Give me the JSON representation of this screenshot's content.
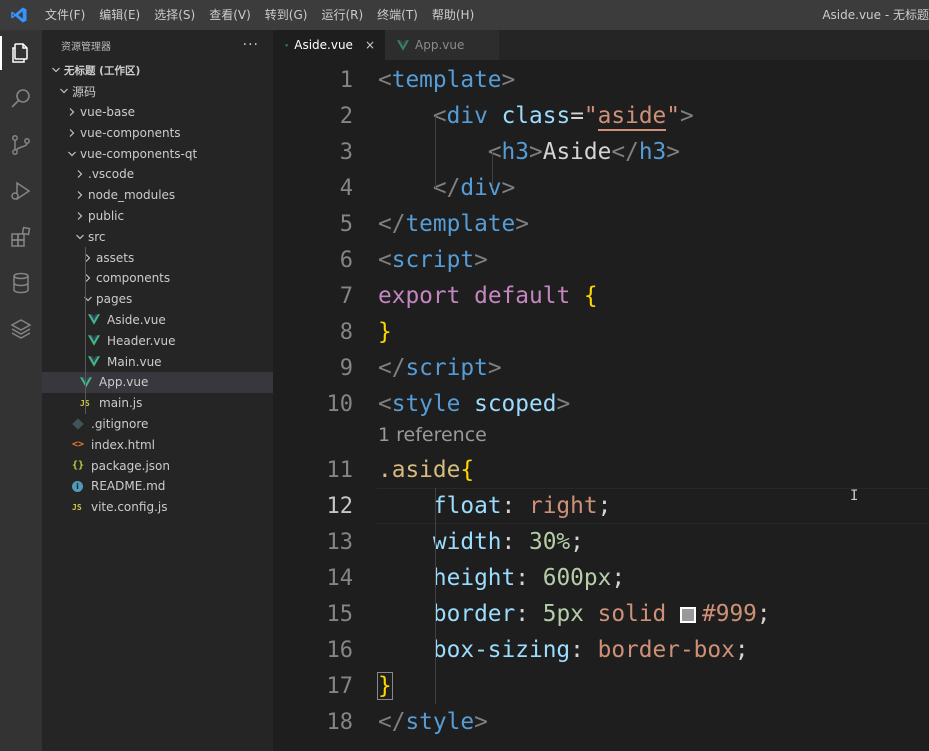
{
  "titlebar": {
    "menu": [
      "文件(F)",
      "编辑(E)",
      "选择(S)",
      "查看(V)",
      "转到(G)",
      "运行(R)",
      "终端(T)",
      "帮助(H)"
    ],
    "window_title": "Aside.vue - 无标题"
  },
  "activity_bar": {
    "icons": [
      "explorer-icon",
      "search-icon",
      "source-control-icon",
      "run-debug-icon",
      "extensions-icon",
      "database-icon",
      "layers-icon"
    ]
  },
  "sidebar": {
    "title": "资源管理器",
    "more": "···",
    "tree": [
      {
        "label": "无标题 (工作区)",
        "type": "workspace",
        "depth": 0,
        "expanded": true
      },
      {
        "label": "源码",
        "type": "folder",
        "depth": 1,
        "expanded": true
      },
      {
        "label": "vue-base",
        "type": "folder",
        "depth": 2,
        "expanded": false
      },
      {
        "label": "vue-components",
        "type": "folder",
        "depth": 2,
        "expanded": false
      },
      {
        "label": "vue-components-qt",
        "type": "folder",
        "depth": 2,
        "expanded": true
      },
      {
        "label": ".vscode",
        "type": "folder",
        "depth": 3,
        "expanded": false
      },
      {
        "label": "node_modules",
        "type": "folder",
        "depth": 3,
        "expanded": false
      },
      {
        "label": "public",
        "type": "folder",
        "depth": 3,
        "expanded": false
      },
      {
        "label": "src",
        "type": "folder",
        "depth": 3,
        "expanded": true
      },
      {
        "label": "assets",
        "type": "folder",
        "depth": 4,
        "expanded": false
      },
      {
        "label": "components",
        "type": "folder",
        "depth": 4,
        "expanded": false
      },
      {
        "label": "pages",
        "type": "folder",
        "depth": 4,
        "expanded": true
      },
      {
        "label": "Aside.vue",
        "type": "vue",
        "depth": 5
      },
      {
        "label": "Header.vue",
        "type": "vue",
        "depth": 5
      },
      {
        "label": "Main.vue",
        "type": "vue",
        "depth": 5
      },
      {
        "label": "App.vue",
        "type": "vue",
        "depth": 4,
        "selected": true
      },
      {
        "label": "main.js",
        "type": "js",
        "depth": 4
      },
      {
        "label": ".gitignore",
        "type": "git",
        "depth": 3
      },
      {
        "label": "index.html",
        "type": "html",
        "depth": 3
      },
      {
        "label": "package.json",
        "type": "json",
        "depth": 3
      },
      {
        "label": "README.md",
        "type": "info",
        "depth": 3
      },
      {
        "label": "vite.config.js",
        "type": "js",
        "depth": 3
      }
    ]
  },
  "tabs": [
    {
      "label": "Aside.vue",
      "active": true,
      "close": "×"
    },
    {
      "label": "App.vue",
      "active": false
    }
  ],
  "editor": {
    "current_line": 12,
    "codelens": "1 reference",
    "lines": [
      {
        "n": "1",
        "tokens": [
          [
            "t-punc",
            "<"
          ],
          [
            "t-tag",
            "template"
          ],
          [
            "t-punc",
            ">"
          ]
        ]
      },
      {
        "n": "2",
        "tokens": [
          [
            "t-text",
            "    "
          ],
          [
            "t-punc",
            "<"
          ],
          [
            "t-tag",
            "div"
          ],
          [
            "t-text",
            " "
          ],
          [
            "t-attr",
            "class"
          ],
          [
            "t-text",
            "="
          ],
          [
            "t-str",
            "\""
          ],
          [
            "t-str u-orange",
            "aside"
          ],
          [
            "t-str",
            "\""
          ],
          [
            "t-punc",
            ">"
          ]
        ]
      },
      {
        "n": "3",
        "tokens": [
          [
            "t-text",
            "        "
          ],
          [
            "t-punc",
            "<"
          ],
          [
            "t-tag",
            "h3"
          ],
          [
            "t-punc",
            ">"
          ],
          [
            "t-text",
            "Aside"
          ],
          [
            "t-punc",
            "</"
          ],
          [
            "t-tag",
            "h3"
          ],
          [
            "t-punc",
            ">"
          ]
        ]
      },
      {
        "n": "4",
        "tokens": [
          [
            "t-text",
            "    "
          ],
          [
            "t-punc",
            "</"
          ],
          [
            "t-tag",
            "div"
          ],
          [
            "t-punc",
            ">"
          ]
        ]
      },
      {
        "n": "5",
        "tokens": [
          [
            "t-punc",
            "</"
          ],
          [
            "t-tag",
            "template"
          ],
          [
            "t-punc",
            ">"
          ]
        ]
      },
      {
        "n": "6",
        "tokens": [
          [
            "t-punc",
            "<"
          ],
          [
            "t-tag",
            "script"
          ],
          [
            "t-punc",
            ">"
          ]
        ]
      },
      {
        "n": "7",
        "tokens": [
          [
            "t-kw",
            "export"
          ],
          [
            "t-text",
            " "
          ],
          [
            "t-kw",
            "default"
          ],
          [
            "t-text",
            " "
          ],
          [
            "t-brace",
            "{"
          ]
        ]
      },
      {
        "n": "8",
        "tokens": [
          [
            "t-brace",
            "}"
          ]
        ]
      },
      {
        "n": "9",
        "tokens": [
          [
            "t-punc",
            "</"
          ],
          [
            "t-tag",
            "script"
          ],
          [
            "t-punc",
            ">"
          ]
        ]
      },
      {
        "n": "10",
        "tokens": [
          [
            "t-punc",
            "<"
          ],
          [
            "t-tag",
            "style"
          ],
          [
            "t-text",
            " "
          ],
          [
            "t-attr",
            "scoped"
          ],
          [
            "t-punc",
            ">"
          ]
        ]
      },
      {
        "n": "11",
        "tokens": [
          [
            "t-sel",
            ".aside"
          ],
          [
            "t-brace",
            "{"
          ]
        ]
      },
      {
        "n": "12",
        "tokens": [
          [
            "t-text",
            "    "
          ],
          [
            "t-prop",
            "float"
          ],
          [
            "t-text",
            ": "
          ],
          [
            "t-val",
            "right"
          ],
          [
            "t-text",
            ";"
          ]
        ]
      },
      {
        "n": "13",
        "tokens": [
          [
            "t-text",
            "    "
          ],
          [
            "t-prop",
            "width"
          ],
          [
            "t-text",
            ": "
          ],
          [
            "t-num",
            "30%"
          ],
          [
            "t-text",
            ";"
          ]
        ]
      },
      {
        "n": "14",
        "tokens": [
          [
            "t-text",
            "    "
          ],
          [
            "t-prop",
            "height"
          ],
          [
            "t-text",
            ": "
          ],
          [
            "t-num",
            "600px"
          ],
          [
            "t-text",
            ";"
          ]
        ]
      },
      {
        "n": "15",
        "tokens": [
          [
            "t-text",
            "    "
          ],
          [
            "t-prop",
            "border"
          ],
          [
            "t-text",
            ": "
          ],
          [
            "t-num",
            "5px"
          ],
          [
            "t-text",
            " "
          ],
          [
            "t-val",
            "solid"
          ],
          [
            "t-text",
            " "
          ],
          [
            "swatch",
            ""
          ],
          [
            "t-val",
            "#999"
          ],
          [
            "t-text",
            ";"
          ]
        ]
      },
      {
        "n": "16",
        "tokens": [
          [
            "t-text",
            "    "
          ],
          [
            "t-prop",
            "box-sizing"
          ],
          [
            "t-text",
            ": "
          ],
          [
            "t-val",
            "border-box"
          ],
          [
            "t-text",
            ";"
          ]
        ]
      },
      {
        "n": "17",
        "tokens": [
          [
            "t-brace brace-box",
            "}"
          ]
        ]
      },
      {
        "n": "18",
        "tokens": [
          [
            "t-punc",
            "</"
          ],
          [
            "t-tag",
            "style"
          ],
          [
            "t-punc",
            ">"
          ]
        ]
      }
    ]
  },
  "colors": {
    "titlebar": "#3c3c3c",
    "activity_bar": "#333333",
    "sidebar": "#252526",
    "editor": "#1e1e1e",
    "vue_green": "#41b883",
    "swatch": "#999999"
  }
}
